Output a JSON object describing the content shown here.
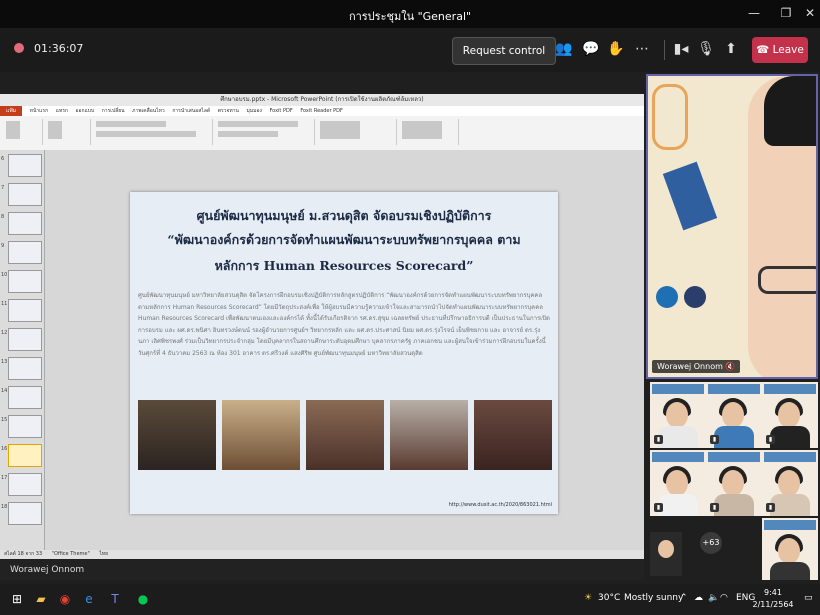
{
  "window": {
    "title": "การประชุมใน \"General\""
  },
  "meeting": {
    "elapsed": "01:36:07",
    "request_control_label": "Request control",
    "leave_label": "Leave"
  },
  "powerpoint": {
    "window_title": "ศึกษาอบรม.pptx - Microsoft PowerPoint (การเปิดใช้งานผลิตภัณฑ์ล้มเหลว)",
    "tabs": [
      "แฟ้ม",
      "หน้าแรก",
      "แทรก",
      "ออกแบบ",
      "การเปลี่ยน",
      "ภาพเคลื่อนไหว",
      "การนำเสนอสไลด์",
      "ตรวจทาน",
      "มุมมอง",
      "Foxit PDF",
      "Foxit Reader PDF"
    ],
    "status_left": "สไลด์ 18 จาก 33",
    "status_theme": "\"Office Theme\"",
    "status_lang": "ไทย"
  },
  "slide": {
    "title_line1": "ศูนย์พัฒนาทุนมนุษย์ ม.สวนดุสิต จัดอบรมเชิงปฏิบัติการ",
    "title_line2": "“พัฒนาองค์กรด้วยการจัดทำแผนพัฒนาระบบทรัพยากรบุคคล ตาม",
    "title_line3": "หลักการ Human Resources Scorecard”",
    "body": "ศูนย์พัฒนาทุนมนุษย์ มหาวิทยาลัยสวนดุสิต จัดโครงการฝึกอบรมเชิงปฏิบัติการหลักสูตรปฏิบัติการ “พัฒนาองค์กรด้วยการจัดทำแผนพัฒนาระบบทรัพยากรบุคคล ตามหลักการ Human Resources Scorecard” โดยมีวัตถุประสงค์เพื่อ ให้ผู้อบรมมีความรู้ความเข้าใจและสามารถนำไปจัดทำแผนพัฒนาระบบทรัพยากรบุคคล Human Resources Scorecard เพื่อพัฒนาตนเองและองค์กรได้ ทั้งนี้ได้รับเกียรติจาก รศ.ดร.สุขุม เฉลยทรัพย์ ประธานที่ปรึกษาอธิการบดี เป็นประธานในการเปิดการอบรม และ ผศ.ดร.พนิศา อินทรวงษ์ตนน์ รองผู้อำนวยการศูนย์ฯ วิทยากรหลัก และ ผศ.ดร.ประศาสน์ นิยม ผศ.ดร.รุ่งโรจน์ เย็นพิชยกาย และ อาจารย์ ดร.รุ่งนภา เลิศพิชรพงศ์ ร่วมเป็นวิทยากรประจำกลุ่ม โดยมีบุคลากรในสถานศึกษาระดับอุดมศึกษา บุคลากรภาครัฐ ภาคเอกชน และผู้สนใจเข้าร่วมการฝึกอบรมในครั้งนี้ วันศุกร์ที่ 4 ธันวาคม 2563 ณ ห้อง 301 อาคาร ดร.ศรีวงค์ แสงศิริพ ศูนย์พัฒนาทุนมนุษย์ มหาวิทยาลัยสวนดุสิต",
    "url": "http://www.dusit.ac.th/2020/863021.html"
  },
  "presenter_name": "Worawej Onnom",
  "spotlight_name": "Worawej Onnom",
  "overflow_count": "+63",
  "weather": {
    "temp": "30°C",
    "desc": "Mostly sunny"
  },
  "tray_lang": "ENG",
  "clock": {
    "time": "9:41",
    "date": "2/11/2564"
  },
  "colors": {
    "leave": "#c4314b",
    "spotlight_border": "#6264a7",
    "file_tab": "#c43e1c",
    "recording": "#e06b7a"
  }
}
